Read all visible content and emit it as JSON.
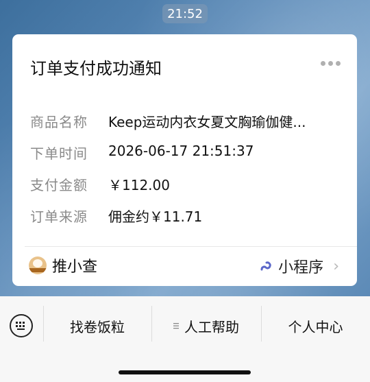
{
  "status": {
    "time": "21:52"
  },
  "card": {
    "title": "订单支付成功通知",
    "rows": [
      {
        "key": "商品名称",
        "value": "Keep运动内衣女夏文胸瑜伽健..."
      },
      {
        "key": "下单时间",
        "value": "2026-06-17 21:51:37"
      },
      {
        "key": "支付金额",
        "value": "￥112.00"
      },
      {
        "key": "订单来源",
        "value": "佣金约￥11.71"
      }
    ],
    "footer": {
      "brand": "推小查",
      "mini_program": "小程序"
    }
  },
  "menu": {
    "items": [
      {
        "label": "找卷饭粒"
      },
      {
        "label": "人工帮助",
        "has_submenu": true
      },
      {
        "label": "个人中心"
      }
    ]
  },
  "colors": {
    "accent_link": "#5b67c9",
    "text_muted": "#8a8a8a"
  }
}
